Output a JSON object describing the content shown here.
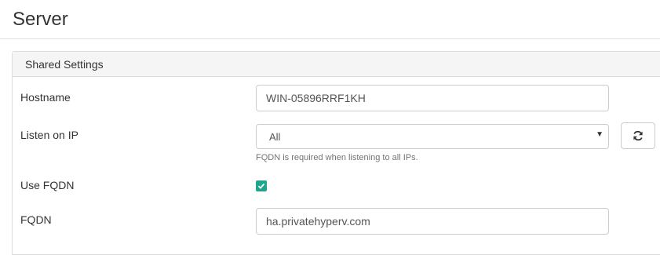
{
  "page": {
    "title": "Server"
  },
  "panel": {
    "title": "Shared Settings",
    "hostname": {
      "label": "Hostname",
      "value": "WIN-05896RRF1KH"
    },
    "listen_ip": {
      "label": "Listen on IP",
      "selected": "All",
      "help": "FQDN is required when listening to all IPs.",
      "refresh_icon": "refresh-icon"
    },
    "use_fqdn": {
      "label": "Use FQDN",
      "checked": true
    },
    "fqdn": {
      "label": "FQDN",
      "value": "ha.privatehyperv.com"
    }
  },
  "colors": {
    "accent": "#20a58a"
  }
}
